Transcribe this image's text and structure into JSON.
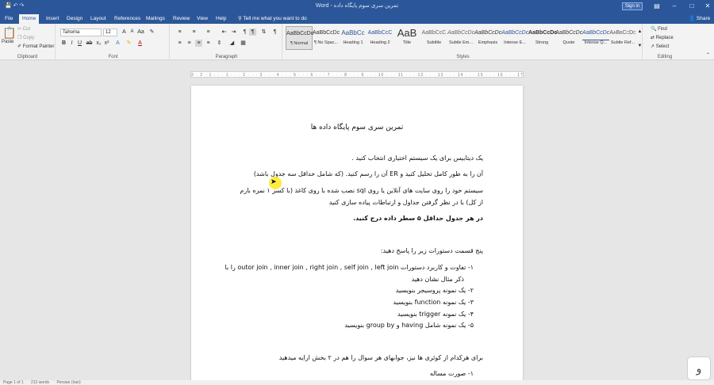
{
  "window": {
    "title": "Word - تمرین سری سوم پایگاه داده",
    "sign_in": "Sign in",
    "share": "Share"
  },
  "tabs": [
    "File",
    "Home",
    "Insert",
    "Design",
    "Layout",
    "References",
    "Mailings",
    "Review",
    "View",
    "Help"
  ],
  "tell_me": "Tell me what you want to do",
  "ribbon": {
    "clipboard": {
      "label": "Clipboard",
      "paste": "Paste",
      "cut": "Cut",
      "copy": "Copy",
      "format_painter": "Format Painter"
    },
    "font": {
      "label": "Font",
      "font_name": "Tahoma",
      "font_size": "12"
    },
    "paragraph": {
      "label": "Paragraph"
    },
    "styles": {
      "label": "Styles",
      "items": [
        {
          "sample": "AaBbCcDc",
          "name": "¶ Normal"
        },
        {
          "sample": "AaBbCcDc",
          "name": "¶ No Spac..."
        },
        {
          "sample": "AaBbCc",
          "name": "Heading 1"
        },
        {
          "sample": "AaBbCcC",
          "name": "Heading 2"
        },
        {
          "sample": "AaB",
          "name": "Title"
        },
        {
          "sample": "AaBbCcC",
          "name": "Subtitle"
        },
        {
          "sample": "AaBbCcDc",
          "name": "Subtle Em..."
        },
        {
          "sample": "AaBbCcDc",
          "name": "Emphasis"
        },
        {
          "sample": "AaBbCcDc",
          "name": "Intense E..."
        },
        {
          "sample": "AaBbCcDc",
          "name": "Strong"
        },
        {
          "sample": "AaBbCcDc",
          "name": "Quote"
        },
        {
          "sample": "AaBbCcDc",
          "name": "Intense Q..."
        },
        {
          "sample": "AaBbCcDc",
          "name": "Subtle Ref..."
        }
      ]
    },
    "editing": {
      "label": "Editing",
      "find": "Find",
      "replace": "Replace",
      "select": "Select"
    }
  },
  "document": {
    "title": "تمرین سری سوم پایگاه داده ها",
    "lines": [
      "یک دیتابیس برای یک سیستم اختیاری انتخاب کنید .",
      "آن را به طور کامل تحلیل کنید و ER آن را رسم کنید. (که شامل حداقل سه جدول باشد)",
      "سیستم خود را روی سایت های آنلاین یا روی sql نصب شده با روی کاغذ (با کسر ۱ نمره بارم",
      "از کل) با در نظر گرفتن  جداول و ارتباطات پیاده سازی کنید",
      "در هر جدول حداقل ۵ سطر داده درج کنید.",
      "پنج قسمت دستورات زیر را پاسخ دهید:",
      "۱-  تفاوت و کاربرد دستورات outor join , inner join , right join , self join , left join را با",
      "ذکر مثال نشان دهید",
      "۲-  یک نمونه پروسیجر بنویسید",
      "۳-  یک نمونه function بنویسید",
      "۴-  یک نمونه trigger بنویسید",
      "۵-  یک نمونه شامل  having  و  group by  بنویسید",
      "برای هرکدام از کوئری ها نیز، جوابهای هر سوال را هم در ۲ بخش ارایه میدهید",
      "۱-   صورت مساله"
    ]
  },
  "ruler": "3 · 2 · 1 · · · 1 · · · 2 · · · 3 · · · 4 · · · 5 · · · 6 · · · 7 · · · 8 · · · 9 · · · 10 · · · 11 · · · 12 · · · 13 · · · 14 · · · 15 · · · 16 · · · 17 · · · 18",
  "status": {
    "page": "Page 1 of 1",
    "words": "212 words",
    "lang": "Persian (Iran)"
  }
}
